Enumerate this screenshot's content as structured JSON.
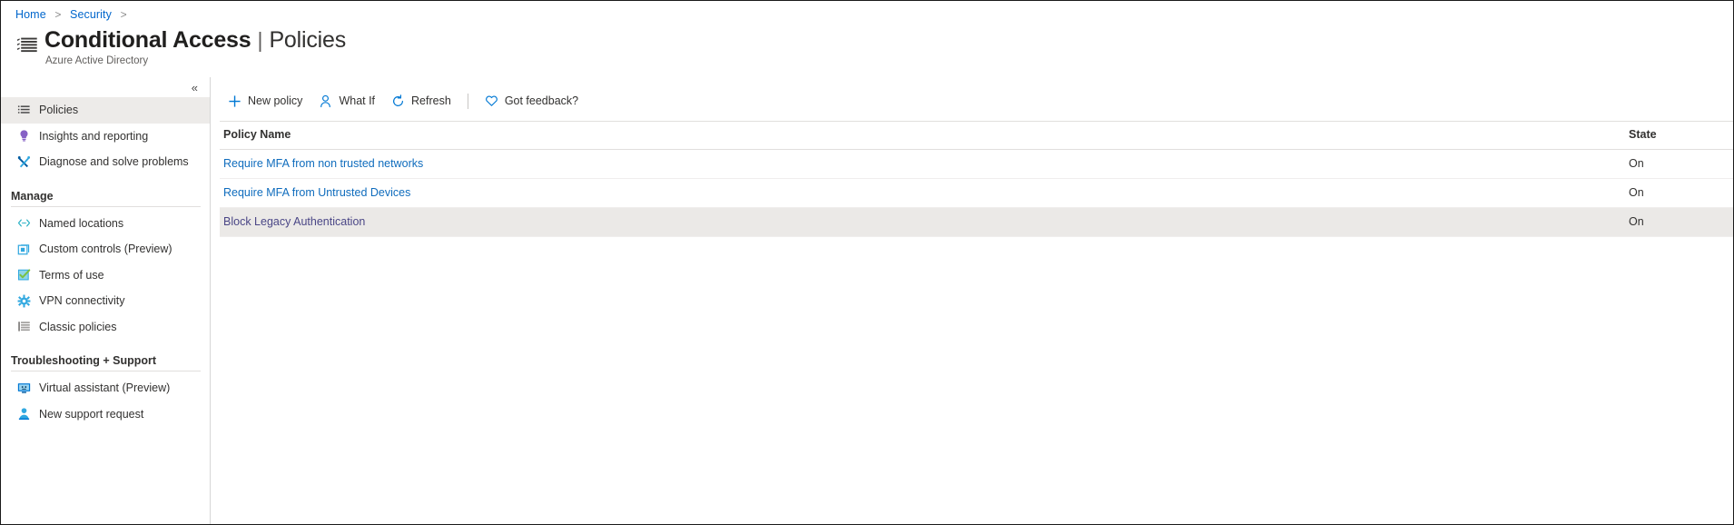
{
  "breadcrumb": {
    "items": [
      "Home",
      "Security"
    ],
    "separator": ">"
  },
  "header": {
    "icon": "list-policies-icon",
    "title": "Conditional Access",
    "divider": "|",
    "subtitle": "Policies",
    "caption": "Azure Active Directory"
  },
  "sidebar": {
    "collapse_label": "«",
    "items": [
      {
        "label": "Policies",
        "icon": "list-icon",
        "selected": true
      },
      {
        "label": "Insights and reporting",
        "icon": "lightbulb-icon",
        "selected": false
      },
      {
        "label": "Diagnose and solve problems",
        "icon": "wrench-screwdriver-icon",
        "selected": false
      }
    ],
    "sections": [
      {
        "title": "Manage",
        "items": [
          {
            "label": "Named locations",
            "icon": "code-brackets-icon"
          },
          {
            "label": "Custom controls (Preview)",
            "icon": "square-overlay-icon"
          },
          {
            "label": "Terms of use",
            "icon": "checkbox-checked-icon"
          },
          {
            "label": "VPN connectivity",
            "icon": "gear-icon"
          },
          {
            "label": "Classic policies",
            "icon": "list-lines-icon"
          }
        ]
      },
      {
        "title": "Troubleshooting + Support",
        "items": [
          {
            "label": "Virtual assistant (Preview)",
            "icon": "monitor-assistant-icon"
          },
          {
            "label": "New support request",
            "icon": "person-support-icon"
          }
        ]
      }
    ]
  },
  "toolbar": {
    "buttons": [
      {
        "label": "New policy",
        "icon": "plus-icon"
      },
      {
        "label": "What If",
        "icon": "person-icon"
      },
      {
        "label": "Refresh",
        "icon": "refresh-icon"
      }
    ],
    "feedback": {
      "label": "Got feedback?",
      "icon": "heart-icon"
    }
  },
  "table": {
    "columns": [
      "Policy Name",
      "State"
    ],
    "rows": [
      {
        "name": "Require MFA from non trusted networks",
        "state": "On",
        "highlight": false,
        "visited": false
      },
      {
        "name": "Require MFA from Untrusted Devices",
        "state": "On",
        "highlight": false,
        "visited": false
      },
      {
        "name": "Block Legacy Authentication",
        "state": "On",
        "highlight": true,
        "visited": true
      }
    ]
  },
  "colors": {
    "link": "#0f6cbd",
    "visited_link": "#5c5a9e",
    "accent": "#0078d4",
    "row_highlight": "#ebe9e7",
    "selected_nav": "#edebe9"
  }
}
